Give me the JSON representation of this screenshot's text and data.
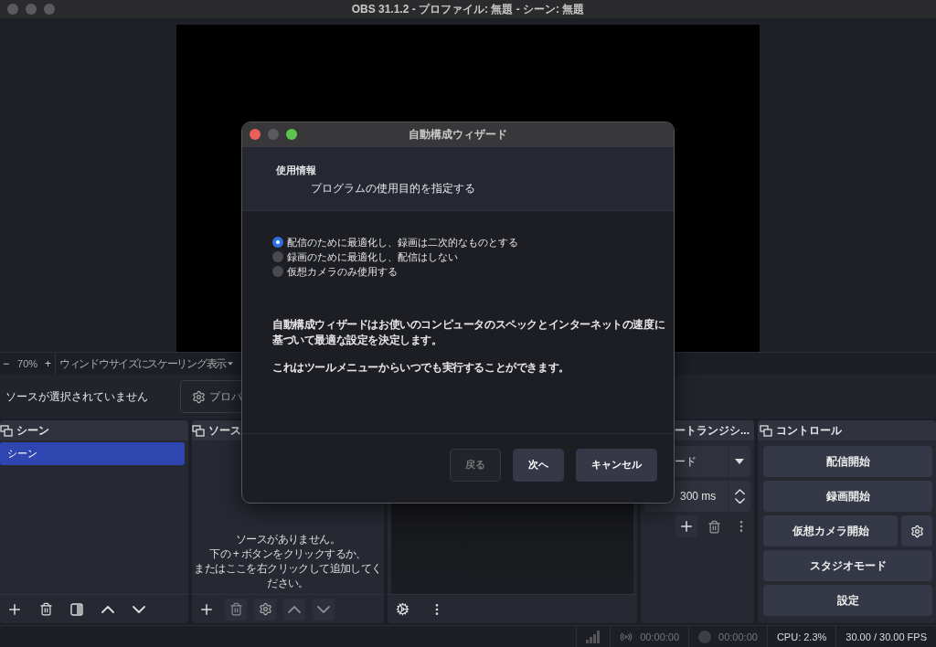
{
  "window": {
    "title": "OBS 31.1.2 - プロファイル: 無題 - シーン: 無題"
  },
  "zoom_bar": {
    "zoom_out": "−",
    "zoom": "70%",
    "zoom_in": "+",
    "scale_mode": "ウィンドウサイズにスケーリング表示"
  },
  "context_bar": {
    "message": "ソースが選択されていません",
    "properties_button": "プロパ"
  },
  "scenes": {
    "title": "シーン",
    "items": [
      {
        "label": "シーン",
        "selected": true
      }
    ]
  },
  "sources": {
    "title": "ソース",
    "empty_message": [
      "ソースがありません。",
      "下の + ボタンをクリックするか、",
      "またはここを右クリックして追加してく",
      "ださい。"
    ]
  },
  "transitions": {
    "title": "ートランジシ...",
    "transition": "ード",
    "duration": "300 ms"
  },
  "controls": {
    "title": "コントロール",
    "buttons": [
      {
        "label": "配信開始",
        "kind": "plain"
      },
      {
        "label": "録画開始",
        "kind": "plain"
      },
      {
        "label": "仮想カメラ開始",
        "kind": "with_settings"
      },
      {
        "label": "スタジオモード",
        "kind": "plain"
      },
      {
        "label": "設定",
        "kind": "plain"
      }
    ]
  },
  "status_bar": {
    "stream_time": "00:00:00",
    "record_time": "00:00:00",
    "cpu": "CPU: 2.3%",
    "fps": "30.00 / 30.00 FPS"
  },
  "dialog": {
    "title": "自動構成ウィザード",
    "section_title": "使用情報",
    "section_subtitle": "プログラムの使用目的を指定する",
    "options": [
      {
        "label": "配信のために最適化し、録画は二次的なものとする",
        "selected": true
      },
      {
        "label": "録画のために最適化し、配信はしない",
        "selected": false
      },
      {
        "label": "仮想カメラのみ使用する",
        "selected": false
      }
    ],
    "paragraphs": [
      [
        "自動構成ウィザードはお使いのコンピュータのスペックとインターネットの速度に",
        "基づいて最適な設定を決定します。"
      ],
      [
        "これはツールメニューからいつでも実行することができます。"
      ]
    ],
    "buttons": [
      {
        "label": "戻る",
        "disabled": true
      },
      {
        "label": "次へ",
        "disabled": false
      },
      {
        "label": "キャンセル",
        "disabled": false
      }
    ]
  }
}
